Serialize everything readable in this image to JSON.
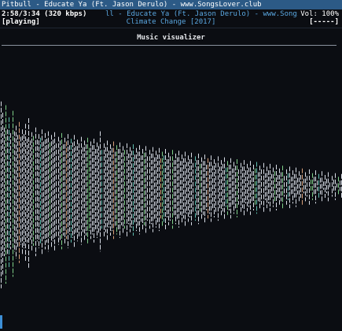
{
  "window": {
    "title": "Pitbull - Educate Ya (Ft. Jason Derulo) - www.SongsLover.club"
  },
  "status": {
    "elapsed": "2:58/3:34 (320 kbps)",
    "song": "ll - Educate Ya (Ft. Jason Derulo) - www.SongsLover.c",
    "volume": "Vol: 100%",
    "state": "[playing]",
    "album": "Climate Change [2017]",
    "progress": "[-----]"
  },
  "visualizer": {
    "title": "Music visualizer",
    "colors": {
      "bar": "#d8dde6",
      "accent_green": "#7fd088",
      "accent_teal": "#5fbfb0",
      "accent_orange": "#d9a07a"
    },
    "levels": [
      0.9,
      0.78,
      0.62,
      0.86,
      0.6,
      0.73,
      0.56,
      0.8,
      0.58,
      0.64,
      0.54,
      0.68,
      0.52,
      0.6,
      0.55,
      0.66,
      0.5,
      0.72,
      0.48,
      0.57,
      0.53,
      0.62,
      0.49,
      0.55,
      0.51,
      0.6,
      0.47,
      0.56,
      0.5,
      0.58,
      0.46,
      0.54,
      0.49,
      0.57,
      0.45,
      0.52,
      0.48,
      0.56,
      0.44,
      0.51,
      0.47,
      0.55,
      0.43,
      0.5,
      0.46,
      0.54,
      0.42,
      0.49,
      0.45,
      0.52,
      0.41,
      0.48,
      0.44,
      0.51,
      0.4,
      0.47,
      0.43,
      0.5,
      0.39,
      0.46,
      0.42,
      0.58,
      0.38,
      0.45,
      0.41,
      0.48,
      0.37,
      0.44,
      0.4,
      0.47,
      0.36,
      0.43,
      0.39,
      0.46,
      0.35,
      0.42,
      0.38,
      0.45,
      0.34,
      0.41,
      0.37,
      0.44,
      0.33,
      0.4,
      0.36,
      0.43,
      0.32,
      0.39,
      0.35,
      0.42,
      0.31,
      0.38,
      0.34,
      0.41,
      0.3,
      0.37,
      0.33,
      0.4,
      0.29,
      0.36,
      0.32,
      0.39,
      0.28,
      0.35,
      0.31,
      0.38,
      0.27,
      0.34,
      0.3,
      0.37,
      0.26,
      0.33,
      0.29,
      0.36,
      0.25,
      0.32,
      0.28,
      0.35,
      0.24,
      0.31,
      0.27,
      0.34,
      0.23,
      0.3,
      0.26,
      0.33,
      0.22,
      0.29,
      0.25,
      0.32,
      0.21,
      0.28,
      0.24,
      0.31,
      0.2,
      0.27,
      0.23,
      0.3,
      0.19,
      0.26,
      0.22,
      0.29,
      0.18,
      0.25,
      0.21,
      0.28,
      0.17,
      0.24,
      0.2,
      0.27,
      0.16,
      0.23,
      0.19,
      0.26,
      0.15,
      0.22,
      0.18,
      0.25,
      0.14,
      0.21,
      0.17,
      0.24,
      0.13,
      0.2,
      0.16,
      0.23,
      0.12,
      0.19,
      0.15,
      0.22,
      0.11,
      0.18,
      0.14,
      0.21,
      0.1,
      0.17,
      0.13,
      0.2,
      0.09,
      0.16,
      0.12,
      0.19,
      0.08,
      0.15,
      0.11,
      0.18,
      0.07,
      0.14,
      0.1,
      0.17,
      0.06,
      0.13,
      0.09,
      0.16,
      0.05,
      0.12,
      0.08,
      0.15,
      0.04,
      0.11,
      0.07,
      0.14,
      0.03,
      0.1,
      0.06,
      0.13,
      0.02,
      0.09,
      0.05,
      0.12
    ]
  }
}
